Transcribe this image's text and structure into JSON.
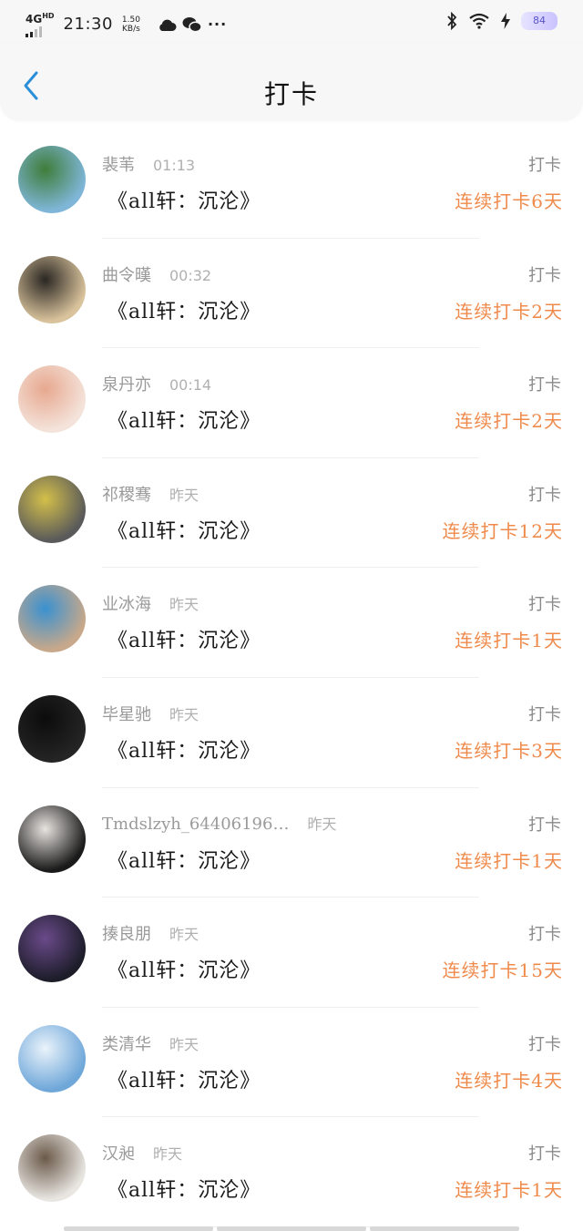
{
  "status_bar": {
    "network": "4G",
    "network_sup": "HD",
    "time": "21:30",
    "speed_value": "1.50",
    "speed_unit": "KB/s",
    "more": "···",
    "battery": "84"
  },
  "header": {
    "title": "打卡"
  },
  "items": [
    {
      "name": "裴苇",
      "time": "01:13",
      "content": "《all轩：沉沦》",
      "action": "打卡",
      "streak": "连续打卡6天",
      "avatar_colors": [
        "#7fb6d8",
        "#3f7d3a"
      ]
    },
    {
      "name": "曲令暵",
      "time": "00:32",
      "content": "《all轩：沉沦》",
      "action": "打卡",
      "streak": "连续打卡2天",
      "avatar_colors": [
        "#d9c39c",
        "#2a2622"
      ]
    },
    {
      "name": "泉丹亦",
      "time": "00:14",
      "content": "《all轩：沉沦》",
      "action": "打卡",
      "streak": "连续打卡2天",
      "avatar_colors": [
        "#f4e3da",
        "#e7a88f"
      ]
    },
    {
      "name": "祁稷骞",
      "time": "昨天",
      "content": "《all轩：沉沦》",
      "action": "打卡",
      "streak": "连续打卡12天",
      "avatar_colors": [
        "#5a5a5a",
        "#d4c04a"
      ]
    },
    {
      "name": "业冰海",
      "time": "昨天",
      "content": "《all轩：沉沦》",
      "action": "打卡",
      "streak": "连续打卡1天",
      "avatar_colors": [
        "#c8a88a",
        "#3a91d0"
      ]
    },
    {
      "name": "毕星驰",
      "time": "昨天",
      "content": "《all轩：沉沦》",
      "action": "打卡",
      "streak": "连续打卡3天",
      "avatar_colors": [
        "#242424",
        "#0c0c0c"
      ]
    },
    {
      "name": "Tmdslzyh_64406196…",
      "time": "昨天",
      "content": "《all轩：沉沦》",
      "action": "打卡",
      "streak": "连续打卡1天",
      "avatar_colors": [
        "#1a1a1a",
        "#e8e4e0"
      ]
    },
    {
      "name": "揍良朋",
      "time": "昨天",
      "content": "《all轩：沉沦》",
      "action": "打卡",
      "streak": "连续打卡15天",
      "avatar_colors": [
        "#1d1d2a",
        "#6a4a8a"
      ]
    },
    {
      "name": "类清华",
      "time": "昨天",
      "content": "《all轩：沉沦》",
      "action": "打卡",
      "streak": "连续打卡4天",
      "avatar_colors": [
        "#6fa7d9",
        "#eaf3fb"
      ]
    },
    {
      "name": "汉昶",
      "time": "昨天",
      "content": "《all轩：沉沦》",
      "action": "打卡",
      "streak": "连续打卡1天",
      "avatar_colors": [
        "#e9e6e2",
        "#6b5a4a"
      ]
    }
  ],
  "colors": {
    "accent": "#ef8a4b",
    "back_arrow": "#2a8fd8",
    "muted_text": "#9a9a9a"
  }
}
